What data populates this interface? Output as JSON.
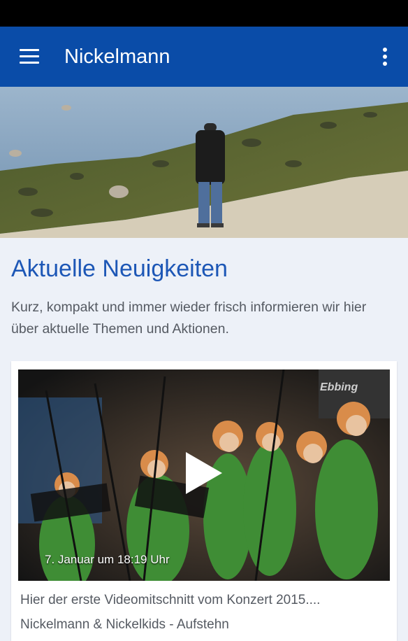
{
  "appbar": {
    "title": "Nickelmann",
    "menu_icon": "hamburger-menu-icon",
    "more_icon": "more-vert-icon",
    "color": "#0a4ca8"
  },
  "hero": {
    "image": "beach-walker-photo"
  },
  "section": {
    "heading": "Aktuelle Neuigkeiten",
    "intro": "Kurz, kompakt und immer wieder frisch informieren wir hier über aktuelle Themen und Aktionen."
  },
  "post": {
    "date": "7. Januar um 18:19 Uhr",
    "description": "Hier der erste Videomitschnitt vom Konzert 2015....",
    "subtitle": "Nickelmann & Nickelkids - Aufstehn",
    "play_icon": "play-icon",
    "thumbnail": "choir-concert-video-thumbnail"
  }
}
